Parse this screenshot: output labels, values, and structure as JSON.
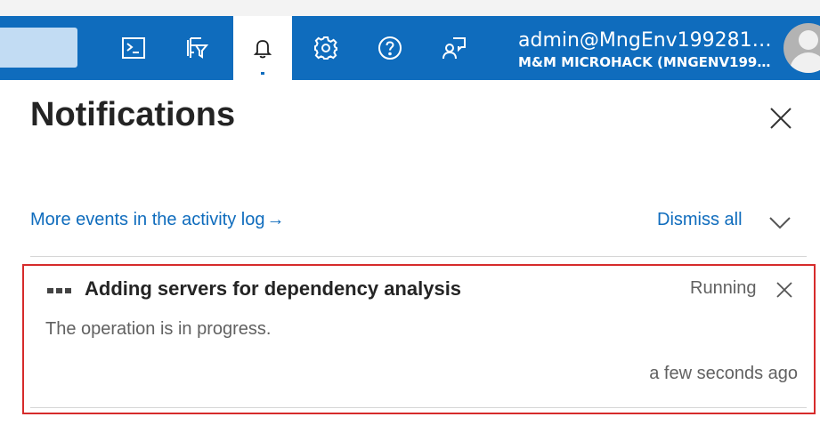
{
  "header": {
    "icons": [
      "cloud-shell-icon",
      "directory-filter-icon",
      "bell-icon",
      "gear-icon",
      "help-icon",
      "feedback-icon"
    ],
    "active_icon": "bell-icon",
    "user_name": "admin@MngEnv199281…",
    "user_tenant": "M&M MICROHACK (MNGENV199…",
    "colors": {
      "bar": "#0f6cbd",
      "search": "#c2dcf3"
    }
  },
  "panel": {
    "title": "Notifications",
    "activity_link": "More events in the activity log",
    "activity_link_arrow": "→",
    "dismiss_all": "Dismiss all"
  },
  "notification": {
    "title": "Adding servers for dependency analysis",
    "status": "Running",
    "description": "The operation is in progress.",
    "time": "a few seconds ago",
    "highlight_color": "#d62b2b"
  }
}
